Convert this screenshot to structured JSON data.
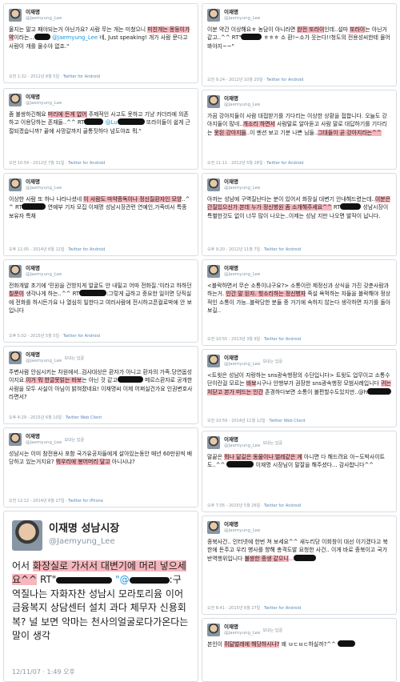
{
  "author": {
    "name": "이재명",
    "handle": "@Jaemyung_Lee",
    "name_big": "이재명 성남시장"
  },
  "retweet_label": "보내는 답글",
  "left": [
    {
      "parts": [
        {
          "t": "물지는 말고 패야되는거 아닌가요? 사람 무는 개는 미쳤으니 "
        },
        {
          "t": "미친개는 몽둥이가 약",
          "h": true
        },
        {
          "t": "이라는...",
          "b": 20
        },
        {
          "t": " "
        },
        {
          "t": "@Jaemyung_Lee",
          "l": true
        },
        {
          "t": " 네, Just speaking! 개가 사람 문다고 사람이 개를 물수야 없죠.\""
        }
      ],
      "meta": "오전 1:32 - 2012년 8월 5일 · ",
      "via": "Twitter for Android"
    },
    {
      "parts": [
        {
          "t": "좀 불쌍하긴해요 "
        },
        {
          "t": "머리에 든게 없어",
          "h": true
        },
        {
          "t": " 주제적인 사고도 못하고 기냥 카더라에 의존하고 이용당하는 존재들..^^ RT"
        },
        {
          "b": 24
        },
        {
          "t": " "
        },
        {
          "t": "@Lu",
          "l": true
        },
        {
          "b": 34
        },
        {
          "t": " 또라이들이 쉽게 근절되겠습니까? 끝에 사망갈까지 골통짓하다 넘도야죠 뭐.\""
        }
      ],
      "meta": "오전 10:54 - 2012년 7월 31일 · ",
      "via": "Twitter for Android"
    },
    {
      "parts": [
        {
          "t": "이상한 사람 또 하나 나타나셨네 "
        },
        {
          "t": "이 사람도 마약중독이나 정신질환자인 모양",
          "h": true
        },
        {
          "t": "..^^ RT"
        },
        {
          "b": 30
        },
        {
          "t": " 연예부 기자 모집 이재명 성남시장관련 연예인,가족비사 특종 보유자 특채"
        }
      ],
      "meta": "오후 11:05 - 2014년 6월 12일 · ",
      "via": "Twitter for Android"
    },
    {
      "parts": [
        {
          "t": "전화개발 초기에 '민원을 건방지게 얼굴도 안 내밀고 어따 전화질.'이라고 하하던 "
        },
        {
          "t": "칠푼이",
          "h": true
        },
        {
          "t": " 생각나게 하는..^^ RT"
        },
        {
          "b": 34
        },
        {
          "t": ":그렇게 급하고 중요한 일이면 당직실에 전화를 하시든가요 나 열심히 일한다고 여러사람에 전시하고픈컬로박에 안 보입니다"
        }
      ],
      "meta": "오후 5:02 - 2015년 5월 5일 · ",
      "via": "Twitter for Android"
    },
    {
      "reply": true,
      "parts": [
        {
          "t": "주변사람 안심시키는 차원에서..검사대상은 환자가 아니고 환자의 가족.당연옵성이지요."
        },
        {
          "t": "이거 뭐 한글못읽는 바보",
          "h": true
        },
        {
          "t": "는 아닌 것 같고"
        },
        {
          "b": 32
        },
        {
          "t": " 메르스환자로 공개한 사람을 모두 사실이 아님이 밝혀졌네요!  이재명씨 이제 어쩌실건가요 인권변호사라면서?"
        }
      ],
      "meta": "오후 4:29 - 2015년 6월 10일 · ",
      "via": "Twitter Web Client"
    },
    {
      "reply": true,
      "parts": [
        {
          "t": "성남시는 이미 참전용사 포함 국가유공자들에게 살아있는동안 매년 60만원씩 배당하고 있는거지요? "
        },
        {
          "t": "뭐우리에 봉어머리 달고",
          "h": true
        },
        {
          "t": " 아니시냐?"
        }
      ],
      "meta": "오전 12:12 - 2014년 6월 27일 · ",
      "via": "Twitter for iPhone"
    }
  ],
  "big": {
    "parts": [
      {
        "t": "어서 "
      },
      {
        "t": "화장실로 가서서 대변기에 머리 넣으세 요^^",
        "h": true
      },
      {
        "t": " RT\""
      },
      {
        "b": 70
      },
      {
        "t": " "
      },
      {
        "t": "\"@",
        "l": true
      },
      {
        "b": 50
      },
      {
        "t": ":구역질나는 자화자찬 성남시 모라토리윰 이어 금융복지 상담센터 설치 과다 체무자 신용회복? 널 보면 악마는 천사의얼굴로다가온다는 말이 생각"
      }
    ],
    "meta": "12/11/07 · 1:49 오후"
  },
  "right": [
    {
      "parts": [
        {
          "t": "이분 약간 이상해요ㅎ 농담이 아니라면 "
        },
        {
          "t": "완전 또라이",
          "h": true
        },
        {
          "t": "인데..설마 "
        },
        {
          "t": "또라이",
          "h": true
        },
        {
          "t": "는 아닌거같고..^^ RT\""
        },
        {
          "b": 26
        },
        {
          "t": " ㅎㅎㅎ 소 환!~소가 웃는다!!청도의 전용성씨한테 물어봐야지~~\""
        }
      ],
      "meta": "오전 9:24 - 2012년 10월 20일 · ",
      "via": "Twitter for Android"
    },
    {
      "parts": [
        {
          "t": "가끔 강아지들이 사람 대접받기를 기다리는 이상한 상황을 접합니다. 오늘도 강아지들이 많네.."
        },
        {
          "t": "개소리 하면서",
          "h": true
        },
        {
          "t": " 사람말로 알아듣고 사람 말로 대답하기를 기다리는 "
        },
        {
          "t": "못된 강아지들",
          "h": true
        },
        {
          "t": "..이 멘션 보고 기분 나쁜 님들.."
        },
        {
          "t": "그대들이 곧 강아지라는^^",
          "h": true
        }
      ],
      "meta": "오전 11:11 - 2012년 5월 28일 · ",
      "via": "Twitter for Android"
    },
    {
      "parts": [
        {
          "t": "아까는 성남에 구역질난다는 분이 있어서 화장실 대변기 안내해드렸는데.."
        },
        {
          "t": "이분은 간질있으신가 본데 누가 정신병원 좀 소개해주세요^^",
          "h": true
        },
        {
          "t": " RT"
        },
        {
          "b": 26
        },
        {
          "t": " 성남시장이 특별한것도 없이 너무 많이 나오는..이제는 성남 지만 나오면 발작이 납니다."
        }
      ],
      "meta": "오후 9:20 - 2012년 11월 7일 · ",
      "via": "Twitter for Android"
    },
    {
      "parts": [
        {
          "t": "<블락하면서 무슨 소통이냐구요?> 소통이란 제정신과 상식을 가진 갖춘사람과 하는거. "
        },
        {
          "t": "인간 말 된자. 헛소리하는 정신병자",
          "h": true
        },
        {
          "t": " 즉설 욕먹하는 자들을 블락해야 정상적인 소통이 가능..블락당한 분들 중 거기에 속하지 않는다 생각하면 자기를 돌아보길.."
        }
      ],
      "meta": "오전 10:55 - 2013년 3월 9일 · ",
      "via": "Twitter for Android"
    },
    {
      "reply": true,
      "parts": [
        {
          "t": "<트윗은 성남이 자랑하는 sns광속행정의 수단입니다> 트윗도 업무이고 소통수단이란걸 모르는 "
        },
        {
          "t": "바보",
          "h": true
        },
        {
          "t": "시구나 안행부가 권장한 sns광속행정 모범사례입니다 "
        },
        {
          "t": "귀는 처닫고 본가 떠드는 인간",
          "h": true
        },
        {
          "t": " 존경하다보면 소통이 불편할수도있지만..@h"
        },
        {
          "b": 30
        }
      ],
      "meta": "오전 10:59 - 2014년 11월 12일 · ",
      "via": "Twitter Web Client"
    },
    {
      "reply": true,
      "parts": [
        {
          "t": "말끝은 "
        },
        {
          "t": "뭐나 닮길은 동물이나 벌레같은 게",
          "h": true
        },
        {
          "t": " 아니면 다 해드려요 아~도박사이트도..^^ "
        },
        {
          "b": 34
        },
        {
          "t": " 이재명 시장님이 말잘을 해주셨다... 감사합니다^^"
        }
      ],
      "meta": "오후 7:05 - 2015년 5월 26일 · ",
      "via": "Twitter for Android"
    },
    {
      "parts": [
        {
          "t": "종북사건.. 인터넷에 한번 쳐 보세요^^ 새누리당 이회창이 대선 이기겠다고 북한에 돈주고 우리 병사를 향해 총격도발 요청한 사건.. 이게 바로 종북이고 국가반역행위입니다 "
        },
        {
          "t": "불쌍한 중생 같으니",
          "h": true
        },
        {
          "t": "..."
        },
        {
          "b": 28
        }
      ],
      "meta": "오전 8:41 - 2015년 6월 27일 · ",
      "via": "Twitter for Android"
    },
    {
      "reply": true,
      "parts": [
        {
          "t": "본인이 "
        },
        {
          "t": "쥐닮벌레에 해당하시나?",
          "h": true
        },
        {
          "t": " 왜 ㅂㄷㅂㄷ하실까?^^ "
        },
        {
          "b": 22
        }
      ],
      "meta": "",
      "via": ""
    }
  ]
}
